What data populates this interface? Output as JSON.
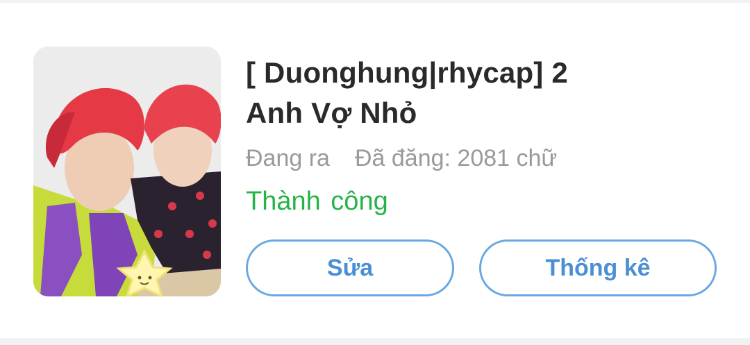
{
  "story": {
    "title_line1": "[ Duonghung|rhycap] 2",
    "title_line2": "Anh Vợ Nhỏ",
    "status_text": "Đang ra",
    "word_count_text": "Đã đăng: 2081 chữ",
    "result_text": "Thành công"
  },
  "actions": {
    "edit_label": "Sửa",
    "stats_label": "Thống kê"
  },
  "colors": {
    "title": "#2a2a2a",
    "meta": "#9a9a9a",
    "success": "#27b347",
    "button_border": "#6aa8e2",
    "button_text": "#4a8fd4"
  }
}
